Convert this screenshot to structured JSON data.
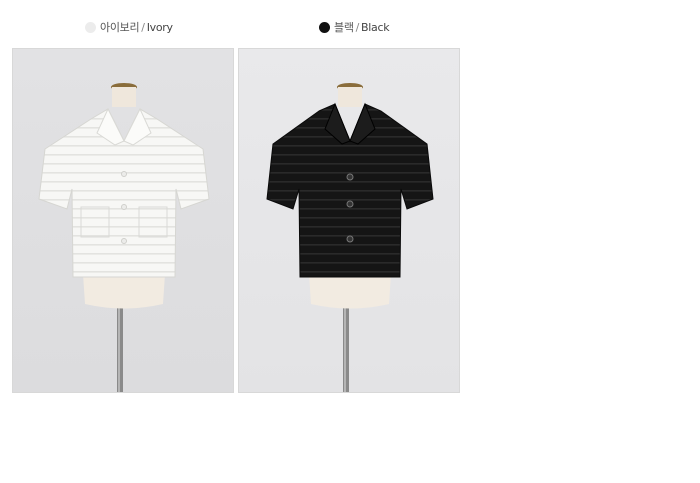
{
  "variants": [
    {
      "swatch_color": "#ececec",
      "label_ko": "아이보리",
      "separator": "/",
      "label_en": "Ivory",
      "image_subject": "ivory short-sleeve lace blouse on mannequin"
    },
    {
      "swatch_color": "#111111",
      "label_ko": "블랙",
      "separator": "/",
      "label_en": "Black",
      "image_subject": "black short-sleeve lace blouse on mannequin"
    }
  ]
}
